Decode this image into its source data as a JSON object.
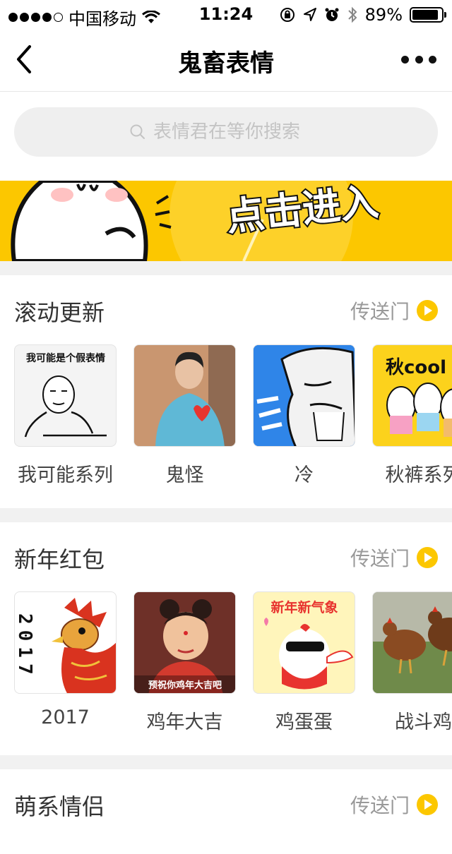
{
  "status_bar": {
    "carrier": "中国移动",
    "time": "11:24",
    "battery": "89%",
    "battery_level": 0.89
  },
  "nav": {
    "title": "鬼畜表情"
  },
  "search": {
    "placeholder": "表情君在等你搜索"
  },
  "banner": {
    "text": "点击进入"
  },
  "sections": [
    {
      "title": "滚动更新",
      "link": "传送门",
      "items": [
        {
          "label": "我可能系列",
          "caption": "我可能是个假表情"
        },
        {
          "label": "鬼怪"
        },
        {
          "label": "冷"
        },
        {
          "label": "秋裤系列",
          "caption": "秋cool"
        }
      ]
    },
    {
      "title": "新年红包",
      "link": "传送门",
      "items": [
        {
          "label": "2017",
          "caption": "2017"
        },
        {
          "label": "鸡年大吉",
          "caption": "预祝你鸡年大吉吧"
        },
        {
          "label": "鸡蛋蛋",
          "caption": "新年新气象"
        },
        {
          "label": "战斗鸡"
        }
      ]
    },
    {
      "title": "萌系情侣",
      "link": "传送门"
    }
  ],
  "colors": {
    "accent": "#fcc700",
    "background": "#f1f1f1"
  }
}
